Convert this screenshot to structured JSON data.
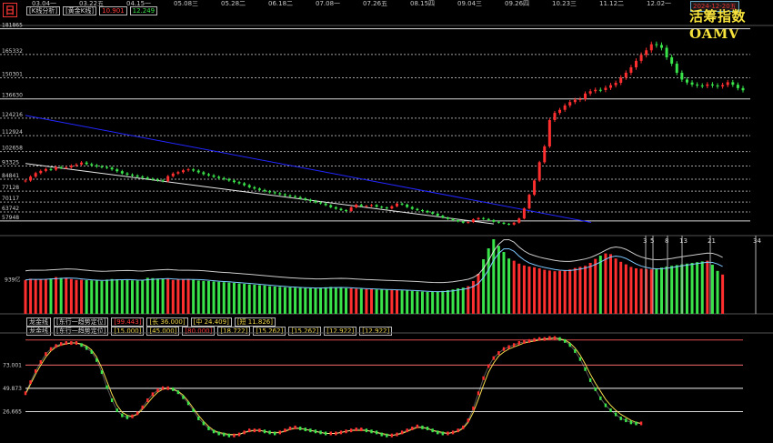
{
  "header": {
    "mode_icon": "日",
    "analysis_label": "[K线分析]",
    "gold_label": "[黄金K线]",
    "gold_red_value": "10.901",
    "gold_green_value": "12.249",
    "title": "活筹指数 OAMV",
    "date_badge": "2024-12-20五"
  },
  "timeline": {
    "labels": [
      "03.04一",
      "03.22五",
      "04.15一",
      "05.08三",
      "05.28二",
      "06.18二",
      "07.08一",
      "07.26五",
      "08.15四",
      "09.04三",
      "09.26四",
      "10.23三",
      "11.12二",
      "12.02一"
    ]
  },
  "colors": {
    "up": "#ff2f2f",
    "down": "#39e34a",
    "trend_blue": "#2327ff",
    "trend_white": "#e8e8e8",
    "panel_grid": "#a0a0a0",
    "fast_line": "#f4d84f",
    "slow_line": "#ff5d5d",
    "volume_line": "#7ec8ff",
    "volume_line_alt": "#ffffff"
  },
  "chart_data": [
    {
      "type": "line",
      "title": "",
      "xlabel": "",
      "ylabel": "",
      "ylim": [
        52000,
        184000
      ],
      "y_ticks": [
        181865,
        165332,
        150301,
        136630,
        124216,
        112924,
        102658,
        93325,
        84841,
        77128,
        70117,
        63742,
        57948
      ],
      "y_ref_lines": [
        181865,
        136630,
        57948
      ],
      "series": [
        {
          "values": [
            84000,
            86500,
            88800,
            90200,
            91400,
            91000,
            92600,
            92300,
            92500,
            93600,
            94300,
            95600,
            94600,
            93800,
            93100,
            92700,
            92300,
            91200,
            90000,
            88600,
            87800,
            87200,
            86500,
            85900,
            85100,
            84700,
            84100,
            83600,
            86800,
            88500,
            89400,
            90600,
            91200,
            90400,
            89300,
            88100,
            87300,
            86400,
            85600,
            84900,
            84000,
            83000,
            82200,
            81000,
            79700,
            78800,
            77900,
            77100,
            76400,
            75800,
            75100,
            74400,
            73900,
            73300,
            72500,
            71600,
            70800,
            69900,
            69200,
            68100,
            66800,
            65800,
            64900,
            64300,
            66700,
            68400,
            67500,
            67600,
            68200,
            67100,
            66600,
            66000,
            67400,
            69100,
            68500,
            66900,
            65700,
            64900,
            64400,
            63500,
            62600,
            61300,
            60100,
            59200,
            58400,
            57600,
            56800,
            57200,
            59000,
            59800,
            59200,
            58500,
            57400,
            56800,
            56100,
            55600,
            56800,
            59500,
            66000,
            74800,
            84000,
            95800,
            106000,
            123000,
            127600,
            129600,
            132400,
            134600,
            136000,
            136500,
            140100,
            141600,
            142500,
            142400,
            143800,
            145500,
            147000,
            150400,
            153500,
            157000,
            161200,
            165000,
            168000,
            171900,
            171400,
            169600,
            163500,
            159400,
            153500,
            149100,
            147200,
            145900,
            145300,
            145000,
            146000,
            145300,
            144700,
            145600,
            147400,
            145800,
            143600,
            142200
          ],
          "name": ""
        }
      ],
      "annotations": [
        "trend line blue",
        "trend line white"
      ]
    },
    {
      "type": "bar",
      "title": "",
      "xlabel": "",
      "ylabel": "",
      "ylim": [
        0,
        2150
      ],
      "y_ticks": [
        939
      ],
      "labels": [
        "3",
        "5",
        "8",
        "13",
        "21",
        "34"
      ],
      "series": [
        {
          "values": [
            930,
            965,
            945,
            950,
            960,
            970,
            1010,
            990,
            985,
            955,
            930,
            935,
            925,
            920,
            915,
            905,
            940,
            955,
            950,
            930,
            925,
            920,
            915,
            930,
            990,
            980,
            970,
            950,
            960,
            930,
            940,
            950,
            960,
            935,
            915,
            905,
            900,
            890,
            880,
            870,
            860,
            850,
            835,
            825,
            810,
            800,
            790,
            780,
            760,
            750,
            740,
            730,
            725,
            720,
            715,
            710,
            705,
            700,
            720,
            730,
            740,
            720,
            715,
            705,
            700,
            690,
            685,
            680,
            675,
            670,
            665,
            660,
            655,
            650,
            645,
            640,
            630,
            620,
            610,
            600,
            600,
            610,
            630,
            650,
            670,
            700,
            720,
            760,
            900,
            1100,
            1500,
            1800,
            2050,
            1870,
            1700,
            1520,
            1460,
            1380,
            1330,
            1300,
            1280,
            1250,
            1210,
            1190,
            1170,
            1180,
            1200,
            1220,
            1260,
            1290,
            1320,
            1400,
            1510,
            1600,
            1660,
            1640,
            1520,
            1430,
            1360,
            1290,
            1250,
            1240,
            1230,
            1220,
            1250,
            1270,
            1300,
            1320,
            1340,
            1360,
            1380,
            1400,
            1420,
            1440,
            1460,
            1350,
            1180,
            1080
          ],
          "name": ""
        }
      ]
    },
    {
      "type": "line",
      "title": "",
      "xlabel": "",
      "ylabel": "",
      "ylim": [
        0,
        105
      ],
      "y_ticks": [
        73.001,
        49.873,
        26.665
      ],
      "legend_row_1": [
        "龙金线",
        "[东行一趋势定位]",
        "[99.443]",
        "[长 36.000]",
        "[中 24.409]",
        "[短 11.826]"
      ],
      "legend_row_2": [
        "龙金线",
        "[东行一趋势定位]",
        "[15.000]",
        "[45.000]",
        "[80.000]",
        "[18.722]",
        "[15.262]",
        "[15.262]",
        "[12.922]",
        "[12.922]"
      ],
      "series": [
        {
          "values": [
            45,
            56,
            67,
            76,
            84,
            89,
            92,
            94,
            95,
            95,
            95,
            93,
            90,
            86,
            78,
            66,
            51,
            38,
            28,
            23,
            21,
            22,
            25,
            31,
            38,
            44,
            48,
            50,
            50,
            49,
            46,
            41,
            35,
            28,
            20,
            15,
            10,
            7,
            5,
            4,
            3,
            3,
            4,
            6,
            8,
            8,
            8,
            7,
            6,
            5,
            6,
            8,
            10,
            11,
            10,
            9,
            8,
            7,
            6,
            5,
            5,
            5,
            6,
            7,
            8,
            9,
            9,
            8,
            7,
            6,
            4,
            3,
            3,
            4,
            6,
            8,
            10,
            12,
            11,
            10,
            8,
            6,
            5,
            5,
            6,
            8,
            11,
            18,
            30,
            45,
            60,
            72,
            80,
            85,
            89,
            91,
            93,
            95,
            96,
            97,
            98,
            99,
            99,
            100,
            100,
            99,
            97,
            93,
            87,
            79,
            69,
            58,
            49,
            40,
            33,
            28,
            24,
            20,
            18,
            16,
            15,
            15
          ],
          "name": ""
        },
        {
          "values": [
            44,
            54,
            64,
            73,
            81,
            87,
            91,
            93,
            94,
            95,
            95,
            94,
            92,
            88,
            81,
            70,
            57,
            44,
            33,
            26,
            23,
            22,
            24,
            29,
            35,
            41,
            46,
            49,
            50,
            49,
            47,
            43,
            37,
            30,
            23,
            17,
            12,
            8,
            6,
            5,
            4,
            4,
            4,
            6,
            7,
            8,
            8,
            7,
            6,
            6,
            6,
            7,
            9,
            10,
            10,
            9,
            8,
            7,
            6,
            5,
            5,
            5,
            6,
            7,
            8,
            8,
            8,
            8,
            7,
            6,
            5,
            4,
            3,
            4,
            5,
            7,
            9,
            11,
            11,
            10,
            8,
            7,
            6,
            5,
            6,
            7,
            10,
            16,
            26,
            39,
            53,
            66,
            75,
            82,
            86,
            89,
            91,
            93,
            95,
            96,
            97,
            98,
            99,
            99,
            100,
            99,
            98,
            95,
            90,
            83,
            74,
            64,
            55,
            47,
            39,
            33,
            28,
            24,
            21,
            18,
            16,
            15
          ],
          "name": ""
        }
      ],
      "y_ref_lines": [
        73.001,
        49.873,
        26.665
      ]
    }
  ]
}
